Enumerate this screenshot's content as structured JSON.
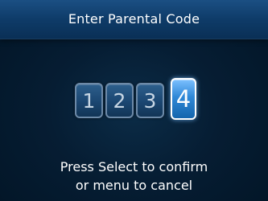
{
  "header": {
    "title": "Enter Parental Code"
  },
  "code": {
    "digits": [
      "1",
      "2",
      "3",
      "4"
    ],
    "active_index": 3
  },
  "instruction": {
    "line1": "Press Select to confirm",
    "line2": "or menu to cancel"
  },
  "colors": {
    "background": "#061d33",
    "header": "#0e3b68",
    "digit_box": "#1b4671",
    "digit_active": "#2f88d7",
    "text": "#ffffff"
  }
}
